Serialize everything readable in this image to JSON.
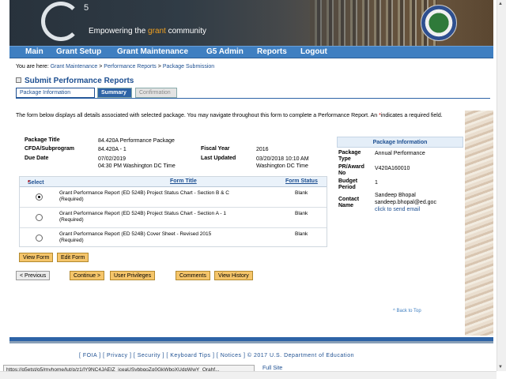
{
  "header": {
    "logo_letter": "G",
    "logo_sup": "5",
    "tagline_pre": "Empowering the ",
    "tagline_accent": "grant",
    "tagline_post": " community"
  },
  "nav": [
    "Main",
    "Grant Setup",
    "Grant Maintenance",
    "G5 Admin",
    "Reports",
    "Logout"
  ],
  "breadcrumb": {
    "prefix": "You are here:",
    "items": [
      "Grant Maintenance",
      "Performance Reports",
      "Package Submission"
    ],
    "sep": ">"
  },
  "page_title": "Submit Performance Reports",
  "tabs": [
    "Package Information",
    "Summary",
    "Confirmation"
  ],
  "intro_a": "The form below displays all details associated with selected package. You may navigate throughout this form to complete a Performance Report.  An ",
  "intro_star": "*",
  "intro_b": "indicates a required field.",
  "info": {
    "package_title_label": "Package Title",
    "package_title": "84.420A Performance Package",
    "cfda_label": "CFDA/Subprogram",
    "cfda": "84.420A - 1",
    "due_label": "Due Date",
    "due_date": "07/02/2019",
    "due_time": "04:30 PM Washington DC Time",
    "fy_label": "Fiscal Year",
    "fy": "2016",
    "updated_label": "Last Updated",
    "updated_date": "03/20/2018 10:10 AM",
    "updated_tz": "Washington DC Time"
  },
  "list": {
    "col_select": "Select",
    "col_star": "*",
    "col_form": "Form Title",
    "col_status": "Form Status",
    "rows": [
      {
        "title": "Grant Performance Report (ED 524B) Project Status Chart - Section B & C",
        "note": "(Required)",
        "status": "Blank"
      },
      {
        "title": "Grant Performance Report (ED 524B) Project Status Chart - Section A - 1",
        "note": "(Required)",
        "status": "Blank"
      },
      {
        "title": "Grant Performance Report (ED 524B) Cover Sheet - Revised 2015",
        "note": "(Required)",
        "status": "Blank"
      }
    ]
  },
  "side": {
    "heading": "Package Information",
    "type_label_a": "Package",
    "type_label_b": "Type",
    "type": "Annual Performance",
    "award_label_a": "PR/Award",
    "award_label_b": "No",
    "award": "V420A160010",
    "period_label_a": "Budget",
    "period_label_b": "Period",
    "period": "1",
    "contact_label_a": "Contact",
    "contact_label_b": "Name",
    "contact_name": "Sandeep Bhopal",
    "contact_email": "sandeep.bhopal@ed.goc",
    "contact_link": "click to send email"
  },
  "buttons": {
    "view_form": "View Form",
    "edit_form": "Edit Form",
    "previous": "< Previous",
    "continue": "Continue >",
    "privileges": "User Privileges",
    "comments": "Comments",
    "history": "View History"
  },
  "back_to_top": "^ Back to Top",
  "footer": "[ FOIA ]  [ Privacy ]  [ Security ]  [ Keyboard Tips ]  [ Notices ]     ©  2017  U.S.  Department  of  Education",
  "status_url": "https://g5etst/g5/myhome/lut/p/z1/lY9NC4JAEIZ_jceaUSvbbgoZq0GkWboXUdpWwY_Qrahf...",
  "full_site": "Full  Site",
  "scroll_up": "▲",
  "scroll_down": "▼"
}
